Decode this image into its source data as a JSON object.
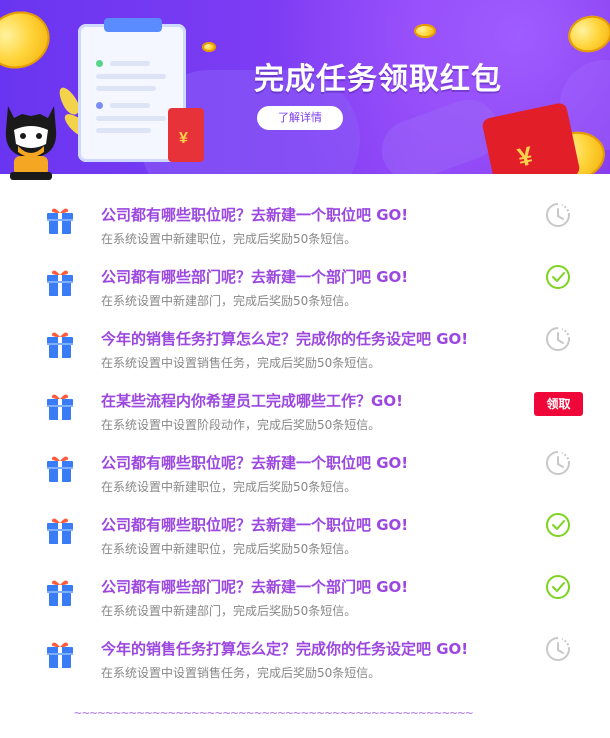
{
  "banner": {
    "title": "完成任务领取红包",
    "detail_button": "了解详情",
    "envelope_symbol": "¥"
  },
  "tasks": [
    {
      "title": "公司都有哪些职位呢？去新建一个职位吧 GO!",
      "desc": "在系统设置中新建职位，完成后奖励50条短信。",
      "status": "pending"
    },
    {
      "title": "公司都有哪些部门呢？去新建一个部门吧 GO!",
      "desc": "在系统设置中新建部门，完成后奖励50条短信。",
      "status": "done"
    },
    {
      "title": "今年的销售任务打算怎么定？完成你的任务设定吧 GO!",
      "desc": "在系统设置中设置销售任务，完成后奖励50条短信。",
      "status": "pending"
    },
    {
      "title": "在某些流程内你希望员工完成哪些工作？GO!",
      "desc": "在系统设置中设置阶段动作，完成后奖励50条短信。",
      "status": "claim",
      "claim_label": "领取"
    },
    {
      "title": "公司都有哪些职位呢？去新建一个职位吧 GO!",
      "desc": "在系统设置中新建职位，完成后奖励50条短信。",
      "status": "pending"
    },
    {
      "title": "公司都有哪些职位呢？去新建一个职位吧 GO!",
      "desc": "在系统设置中新建职位，完成后奖励50条短信。",
      "status": "done"
    },
    {
      "title": "公司都有哪些部门呢？去新建一个部门吧 GO!",
      "desc": "在系统设置中新建部门，完成后奖励50条短信。",
      "status": "done"
    },
    {
      "title": "今年的销售任务打算怎么定？完成你的任务设定吧 GO!",
      "desc": "在系统设置中设置销售任务，完成后奖励50条短信。",
      "status": "pending"
    }
  ],
  "icons": {
    "gift": "gift-icon",
    "pending": "clock-pending-icon",
    "done": "check-circle-icon"
  },
  "colors": {
    "title": "#9b47e0",
    "done": "#7ed321",
    "pending": "#c8c8c8",
    "claim": "#f0073a",
    "gift_blue": "#3a7bf6",
    "gift_ribbon": "#ff5a3c"
  },
  "footer": {
    "decoration": "~~~~~~~~~~~~~~~~~~~~~~~~~~~~~~~~~~~~~~~~~~~~~~~~~~~"
  }
}
